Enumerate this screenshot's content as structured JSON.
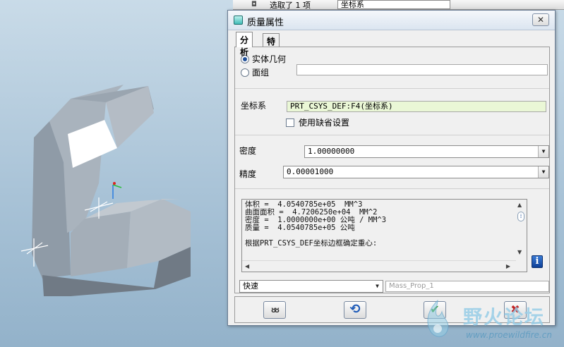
{
  "background_toolbar": {
    "selection_text": "选取了 1 项",
    "filter_value": "坐标系"
  },
  "dialog": {
    "title": "质量属性",
    "close_label": "✕",
    "tabs": [
      {
        "label": "分析",
        "active": true
      },
      {
        "label": "特征",
        "active": false
      }
    ],
    "geometry_options": {
      "solid_label": "实体几何",
      "quilt_label": "面组",
      "selected": "solid",
      "quilt_field_value": ""
    },
    "coordinate_system": {
      "label": "坐标系",
      "value": "PRT_CSYS_DEF:F4(坐标系)",
      "use_default_label": "使用缺省设置",
      "use_default_checked": false
    },
    "density": {
      "label": "密度",
      "value": "1.00000000"
    },
    "precision": {
      "label": "精度",
      "value": "0.00001000"
    },
    "results_lines": [
      "体积 =  4.0540785e+05  MM^3",
      "曲面面积 =  4.7206250e+04  MM^2",
      "密度 =  1.0000000e+00 公吨 / MM^3",
      "质量 =  4.0540785e+05 公吨",
      "",
      "根据PRT_CSYS_DEF坐标边框确定重心:"
    ],
    "mode": {
      "value": "快速"
    },
    "name_field": {
      "value": "Mass_Prop_1"
    },
    "buttons": {
      "preview_glyph": "ᴕᴕ",
      "repeat_glyph": "⟲",
      "ok_glyph": "✔",
      "cancel_glyph": "✖"
    }
  },
  "watermark": {
    "title": "野火论坛",
    "url": "www.proewildfire.cn"
  },
  "colors": {
    "coord_field_bg": "#eaf7d6",
    "ok_green": "#2e9a2e",
    "cancel_red": "#c22020",
    "repeat_blue": "#1e5bb8"
  }
}
